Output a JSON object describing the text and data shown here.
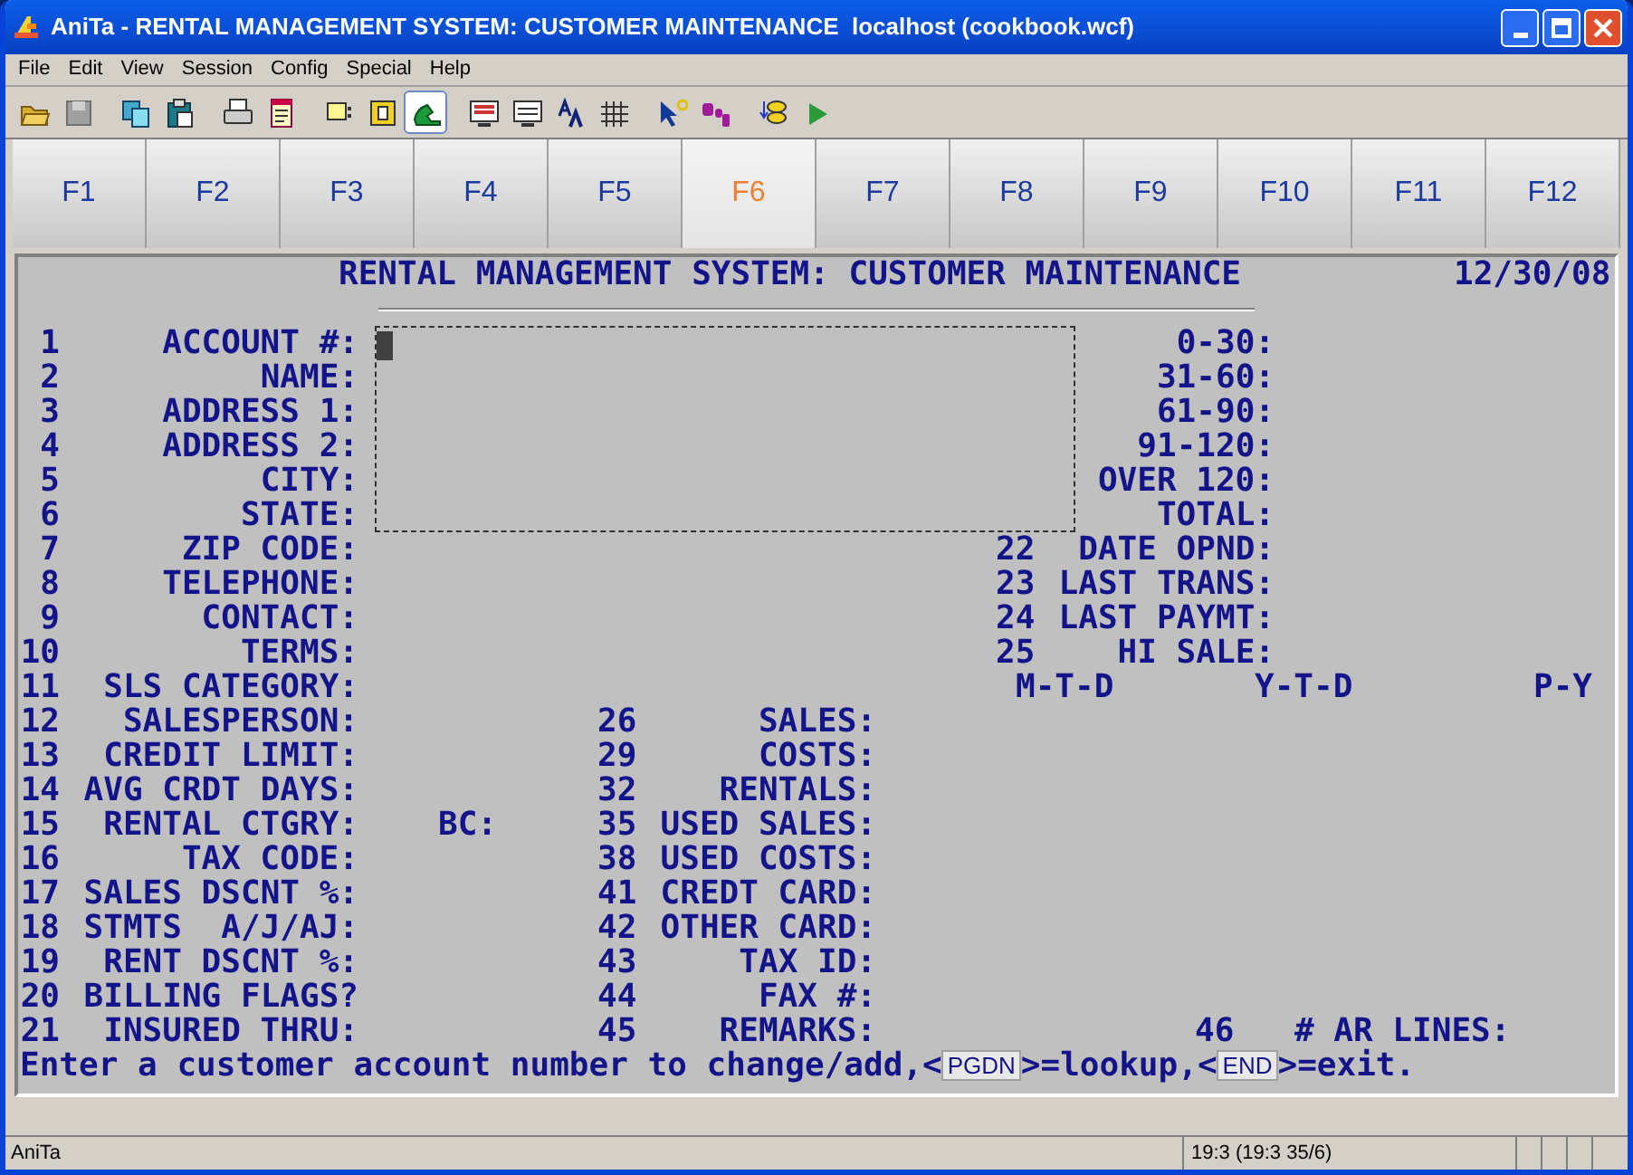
{
  "window": {
    "title": "AniTa - RENTAL MANAGEMENT SYSTEM: CUSTOMER MAINTENANCE  localhost (cookbook.wcf)"
  },
  "menu": [
    "File",
    "Edit",
    "View",
    "Session",
    "Config",
    "Special",
    "Help"
  ],
  "toolbar": [
    {
      "selected": false
    },
    {
      "selected": false
    },
    {
      "selected": false
    },
    {
      "selected": false
    },
    {
      "selected": false
    },
    {
      "selected": false
    },
    {
      "selected": false
    },
    {
      "selected": false
    },
    {
      "selected": true
    },
    {
      "selected": false
    },
    {
      "selected": false
    },
    {
      "selected": false
    },
    {
      "selected": false
    },
    {
      "selected": false
    },
    {
      "selected": false
    },
    {
      "selected": false
    },
    {
      "selected": false
    }
  ],
  "function_keys": [
    {
      "label": "F1",
      "selected": false
    },
    {
      "label": "F2",
      "selected": false
    },
    {
      "label": "F3",
      "selected": false
    },
    {
      "label": "F4",
      "selected": false
    },
    {
      "label": "F5",
      "selected": false
    },
    {
      "label": "F6",
      "selected": true
    },
    {
      "label": "F7",
      "selected": false
    },
    {
      "label": "F8",
      "selected": false
    },
    {
      "label": "F9",
      "selected": false
    },
    {
      "label": "F10",
      "selected": false
    },
    {
      "label": "F11",
      "selected": false
    },
    {
      "label": "F12",
      "selected": false
    }
  ],
  "screen": {
    "title": "RENTAL MANAGEMENT SYSTEM: CUSTOMER MAINTENANCE",
    "date": "12/30/08",
    "fields": [
      {
        "number": "1",
        "label": "ACCOUNT #:"
      },
      {
        "number": "2",
        "label": "NAME:"
      },
      {
        "number": "3",
        "label": "ADDRESS 1:"
      },
      {
        "number": "4",
        "label": "ADDRESS 2:"
      },
      {
        "number": "5",
        "label": "CITY:"
      },
      {
        "number": "6",
        "label": "STATE:"
      },
      {
        "number": "7",
        "label": "ZIP CODE:"
      },
      {
        "number": "8",
        "label": "TELEPHONE:"
      },
      {
        "number": "9",
        "label": "CONTACT:"
      },
      {
        "number": "10",
        "label": "TERMS:"
      },
      {
        "number": "11",
        "label": "SLS CATEGORY:"
      },
      {
        "number": "12",
        "label": "SALESPERSON:"
      },
      {
        "number": "13",
        "label": "CREDIT LIMIT:"
      },
      {
        "number": "14",
        "label": "AVG CRDT DAYS:"
      },
      {
        "number": "15",
        "label": "RENTAL CTGRY:"
      },
      {
        "number": "16",
        "label": "TAX CODE:"
      },
      {
        "number": "17",
        "label": "SALES DSCNT %:"
      },
      {
        "number": "18",
        "label": "STMTS  A/J/AJ:"
      },
      {
        "number": "19",
        "label": "RENT DSCNT %:"
      },
      {
        "number": "20",
        "label": "BILLING FLAGS?"
      },
      {
        "number": "21",
        "label": "INSURED THRU:"
      }
    ],
    "rental_subfield": "BC:",
    "aging": [
      "0-30:",
      "31-60:",
      "61-90:",
      "91-120:",
      "OVER 120:",
      "TOTAL:"
    ],
    "stats": [
      {
        "number": "22",
        "label": "DATE OPND:"
      },
      {
        "number": "23",
        "label": "LAST TRANS:"
      },
      {
        "number": "24",
        "label": "LAST PAYMT:"
      },
      {
        "number": "25",
        "label": "HI SALE:"
      }
    ],
    "period_headers": [
      "M-T-D",
      "Y-T-D",
      "P-Y"
    ],
    "sales_fields": [
      {
        "number": "26",
        "label": "SALES:"
      },
      {
        "number": "29",
        "label": "COSTS:"
      },
      {
        "number": "32",
        "label": "RENTALS:"
      },
      {
        "number": "35",
        "label": "USED SALES:"
      },
      {
        "number": "38",
        "label": "USED COSTS:"
      },
      {
        "number": "41",
        "label": "CREDT CARD:"
      },
      {
        "number": "42",
        "label": "OTHER CARD:"
      },
      {
        "number": "43",
        "label": "TAX ID:"
      },
      {
        "number": "44",
        "label": "FAX #:"
      },
      {
        "number": "45",
        "label": "REMARKS:"
      }
    ],
    "ar_lines": {
      "number": "46",
      "label": "# AR LINES:"
    },
    "prompt": [
      {
        "kind": "text",
        "text": "Enter a customer account number to change/add,<"
      },
      {
        "kind": "key",
        "text": "PGDN"
      },
      {
        "kind": "text",
        "text": ">=lookup,<"
      },
      {
        "kind": "key",
        "text": "END"
      },
      {
        "kind": "text",
        "text": ">=exit."
      }
    ]
  },
  "status_bar": {
    "app": "AniTa",
    "position": "19:3 (19:3 35/6)"
  }
}
